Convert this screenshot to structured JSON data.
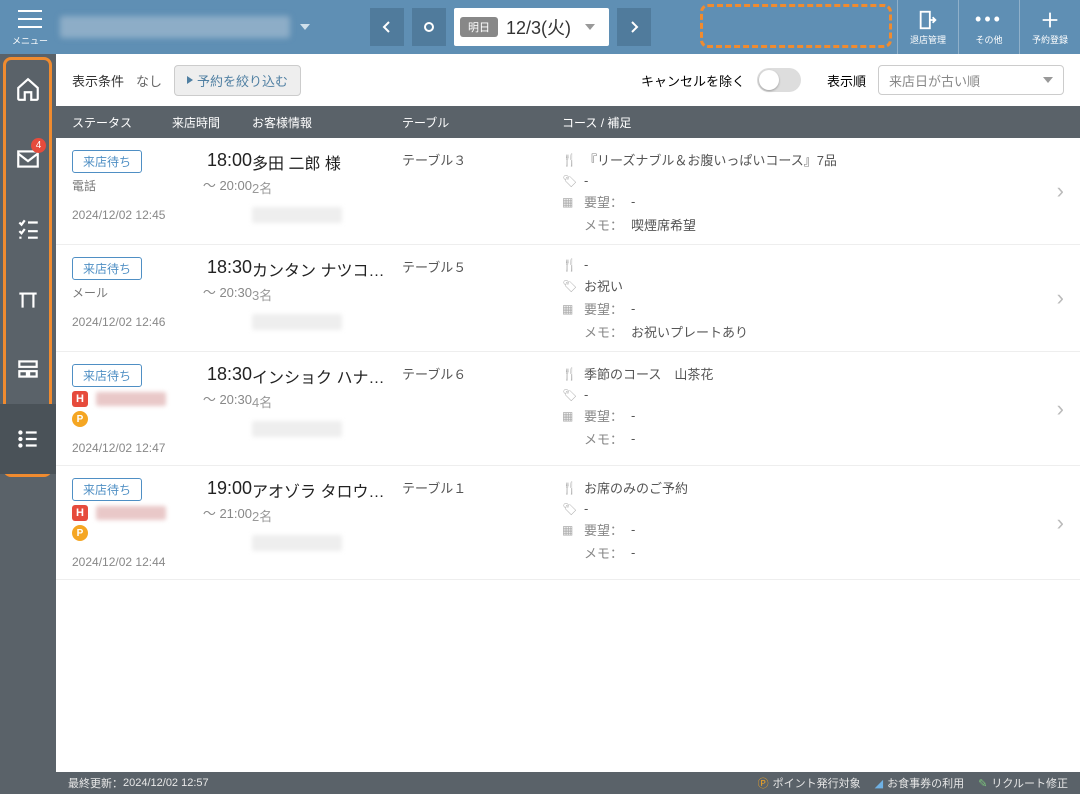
{
  "header": {
    "menu_label": "メニュー",
    "date_badge": "明日",
    "date_text": "12/3(火)",
    "back_label": "退店管理",
    "other_label": "その他",
    "add_label": "予約登録"
  },
  "sidebar": {
    "mail_badge": "4"
  },
  "filter": {
    "label": "表示条件",
    "value": "なし",
    "button": "予約を絞り込む",
    "exclude_cancel": "キャンセルを除く",
    "sort_label": "表示順",
    "sort_value": "来店日が古い順"
  },
  "columns": {
    "status": "ステータス",
    "time": "来店時間",
    "customer": "お客様情報",
    "table": "テーブル",
    "course": "コース / 補足"
  },
  "course_labels": {
    "request_prefix": "要望：",
    "memo_prefix": "メモ："
  },
  "rows": [
    {
      "status": "来店待ち",
      "via": "電話",
      "via_type": "text",
      "timestamp": "2024/12/02 12:45",
      "time_main": "18:00",
      "time_end": "～ 20:00",
      "name": "多田 二郎 様",
      "party": "2名",
      "table": "テーブル３",
      "course": "『リーズナブル＆お腹いっぱいコース』7品",
      "tag": "-",
      "request": "-",
      "memo": "喫煙席希望"
    },
    {
      "status": "来店待ち",
      "via": "メール",
      "via_type": "text",
      "timestamp": "2024/12/02 12:46",
      "time_main": "18:30",
      "time_end": "～ 20:30",
      "name": "カンタン ナツコ…",
      "party": "3名",
      "table": "テーブル５",
      "course": "-",
      "tag": "お祝い",
      "request": "-",
      "memo": "お祝いプレートあり"
    },
    {
      "status": "来店待ち",
      "via_type": "badges",
      "timestamp": "2024/12/02 12:47",
      "time_main": "18:30",
      "time_end": "～ 20:30",
      "name": "インショク ハナ…",
      "party": "4名",
      "table": "テーブル６",
      "course": "季節のコース　山茶花",
      "tag": "-",
      "request": "-",
      "memo": "-"
    },
    {
      "status": "来店待ち",
      "via_type": "badges",
      "timestamp": "2024/12/02 12:44",
      "time_main": "19:00",
      "time_end": "～ 21:00",
      "name": "アオゾラ タロウ…",
      "party": "2名",
      "table": "テーブル１",
      "course": "お席のみのご予約",
      "tag": "-",
      "request": "-",
      "memo": "-"
    }
  ],
  "footer": {
    "updated_label": "最終更新：",
    "updated_at": "2024/12/02 12:57",
    "legend_point": "ポイント発行対象",
    "legend_voucher": "お食事券の利用",
    "legend_recruit": "リクルート修正"
  }
}
